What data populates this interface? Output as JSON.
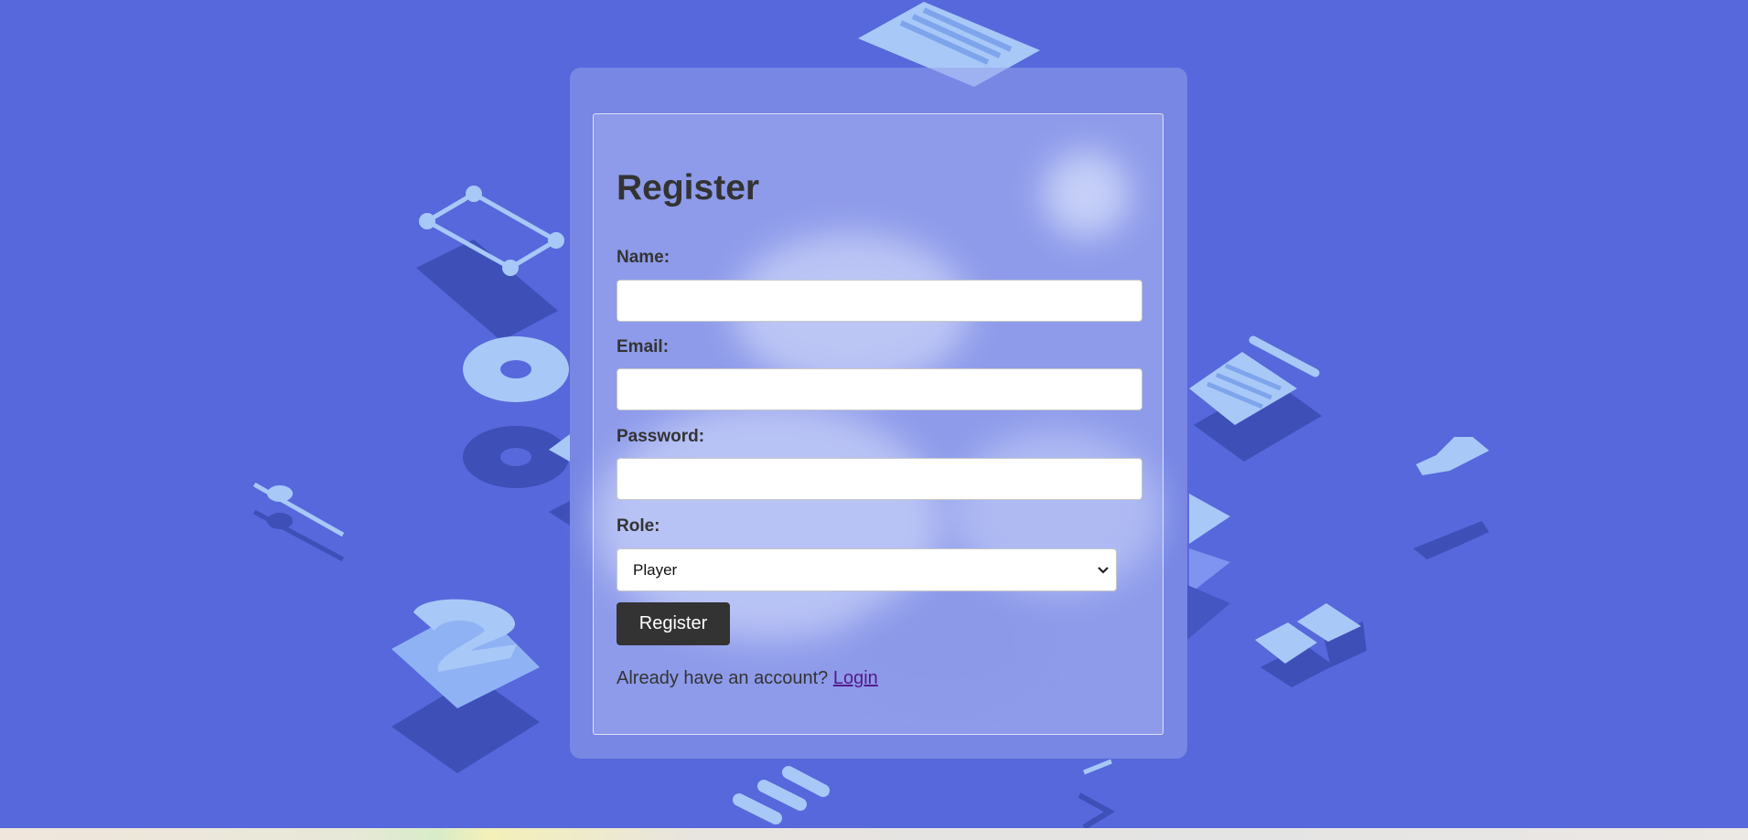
{
  "form": {
    "title": "Register",
    "name_label": "Name:",
    "email_label": "Email:",
    "password_label": "Password:",
    "role_label": "Role:",
    "name_value": "",
    "email_value": "",
    "password_value": "",
    "role_selected": "Player",
    "submit_label": "Register",
    "login_prompt": "Already have an account?",
    "login_link_label": "Login"
  },
  "colors": {
    "background": "#5668db",
    "button": "#333333",
    "link": "#551a8b",
    "text": "#333333"
  },
  "icons": {
    "select_arrow": "chevron-down-icon"
  }
}
